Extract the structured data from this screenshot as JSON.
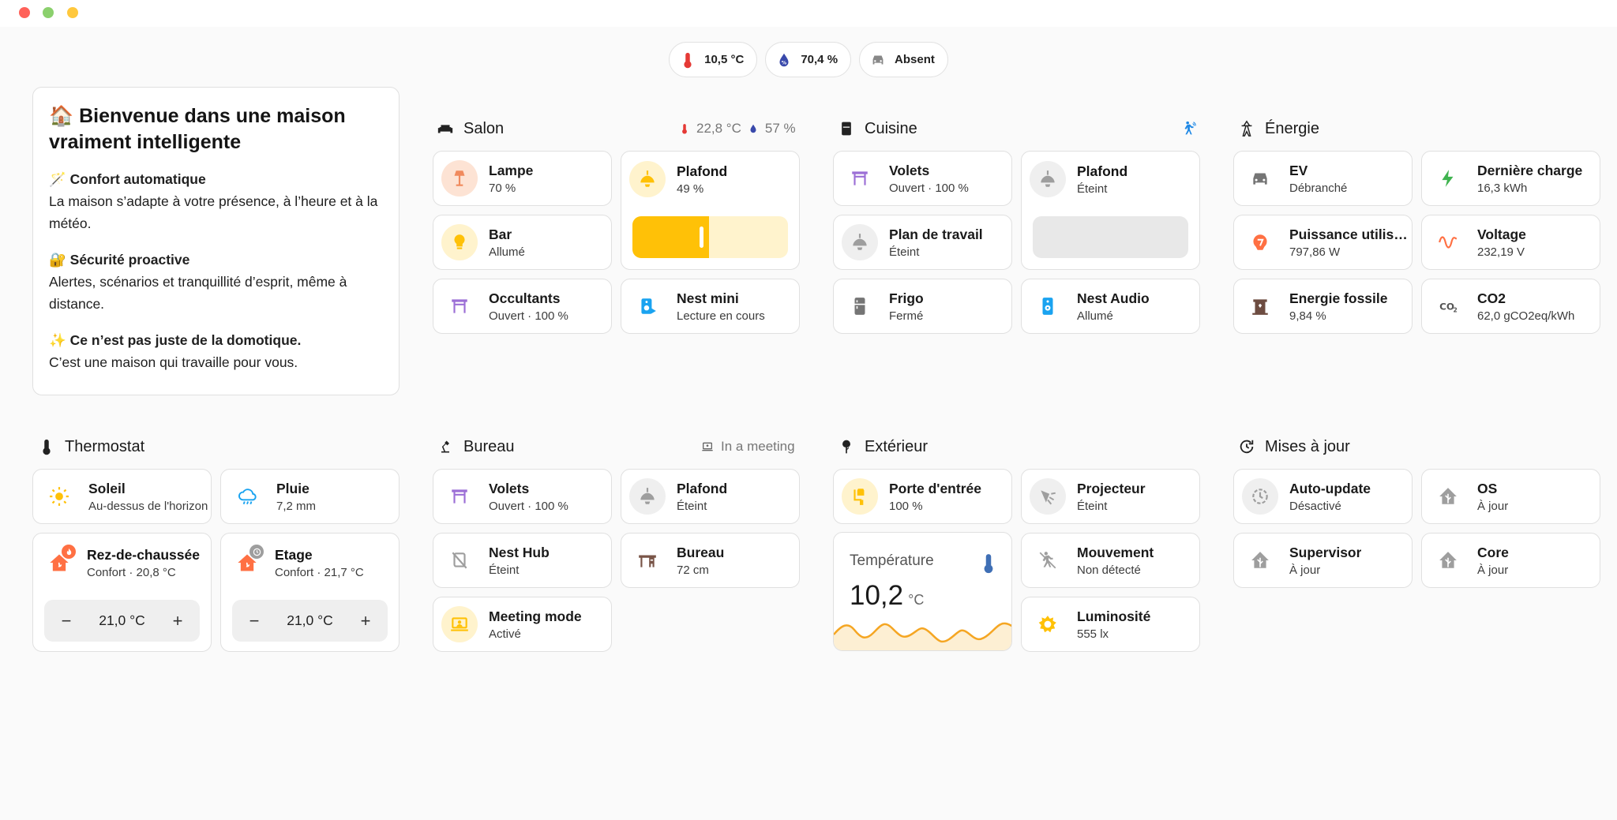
{
  "badges": [
    {
      "icon": "thermometer-icon",
      "text": "10,5 °C"
    },
    {
      "icon": "humidity-icon",
      "text": "70,4 %"
    },
    {
      "icon": "car-icon",
      "text": "Absent"
    }
  ],
  "welcome": {
    "title": "🏠 Bienvenue dans une maison vraiment intelligente",
    "items": [
      {
        "heading": "🪄 Confort automatique",
        "text": "La maison s’adapte à votre présence, à l’heure et à la météo."
      },
      {
        "heading": "🔐 Sécurité proactive",
        "text": "Alertes, scénarios et tranquillité d’esprit, même à distance."
      },
      {
        "heading": "✨ Ce n’est pas juste de la domotique.",
        "text": "C’est une maison qui travaille pour vous."
      }
    ]
  },
  "sections": {
    "salon": {
      "title": "Salon",
      "temp": "22,8 °C",
      "humidity": "57 %"
    },
    "cuisine": {
      "title": "Cuisine"
    },
    "energie": {
      "title": "Énergie"
    },
    "thermostat": {
      "title": "Thermostat"
    },
    "bureau": {
      "title": "Bureau",
      "status": "In a meeting"
    },
    "exterieur": {
      "title": "Extérieur"
    },
    "maj": {
      "title": "Mises à jour"
    }
  },
  "salon": {
    "lampe": {
      "name": "Lampe",
      "state": "70 %"
    },
    "plafond": {
      "name": "Plafond",
      "state": "49 %",
      "level": 0.49
    },
    "bar": {
      "name": "Bar",
      "state": "Allumé"
    },
    "occultants": {
      "name": "Occultants",
      "state": "Ouvert · 100 %"
    },
    "nest_mini": {
      "name": "Nest mini",
      "state": "Lecture en cours"
    }
  },
  "cuisine": {
    "volets": {
      "name": "Volets",
      "state": "Ouvert · 100 %"
    },
    "plafond": {
      "name": "Plafond",
      "state": "Éteint",
      "level": 0
    },
    "plan": {
      "name": "Plan de travail",
      "state": "Éteint"
    },
    "frigo": {
      "name": "Frigo",
      "state": "Fermé"
    },
    "nest_audio": {
      "name": "Nest Audio",
      "state": "Allumé"
    }
  },
  "energie": {
    "ev": {
      "name": "EV",
      "state": "Débranché"
    },
    "charge": {
      "name": "Dernière charge",
      "state": "16,3 kWh"
    },
    "puissance": {
      "name": "Puissance utilisée",
      "state": "797,86 W"
    },
    "voltage": {
      "name": "Voltage",
      "state": "232,19 V"
    },
    "fossile": {
      "name": "Energie fossile",
      "state": "9,84 %"
    },
    "co2": {
      "name": "CO2",
      "state": "62,0 gCO2eq/kWh"
    }
  },
  "thermostat": {
    "soleil": {
      "name": "Soleil",
      "state": "Au-dessus de l'horizon"
    },
    "pluie": {
      "name": "Pluie",
      "state": "7,2 mm"
    },
    "rdc": {
      "name": "Rez-de-chaussée",
      "state": "Confort · 20,8 °C",
      "target": "21,0 °C"
    },
    "etage": {
      "name": "Etage",
      "state": "Confort · 21,7 °C",
      "target": "21,0 °C"
    },
    "minus": "−",
    "plus": "+"
  },
  "bureau": {
    "volets": {
      "name": "Volets",
      "state": "Ouvert · 100 %"
    },
    "plafond": {
      "name": "Plafond",
      "state": "Éteint"
    },
    "nest_hub": {
      "name": "Nest Hub",
      "state": "Éteint"
    },
    "bureau": {
      "name": "Bureau",
      "state": "72 cm"
    },
    "meeting": {
      "name": "Meeting mode",
      "state": "Activé"
    }
  },
  "exterieur": {
    "porte": {
      "name": "Porte d'entrée",
      "state": "100 %"
    },
    "projecteur": {
      "name": "Projecteur",
      "state": "Éteint"
    },
    "temperature": {
      "label": "Température",
      "value": "10,2",
      "unit": "°C"
    },
    "mouvement": {
      "name": "Mouvement",
      "state": "Non détecté"
    },
    "luminosite": {
      "name": "Luminosité",
      "state": "555 lx"
    }
  },
  "maj": {
    "auto": {
      "name": "Auto-update",
      "state": "Désactivé"
    },
    "os": {
      "name": "OS",
      "state": "À jour"
    },
    "supervisor": {
      "name": "Supervisor",
      "state": "À jour"
    },
    "core": {
      "name": "Core",
      "state": "À jour"
    }
  },
  "colors": {
    "accent_yellow": "#ffc107",
    "accent_orange": "#ff7043",
    "accent_purple": "#9c6fd6",
    "accent_blue": "#1aa3f0",
    "accent_green": "#3fb34f"
  }
}
